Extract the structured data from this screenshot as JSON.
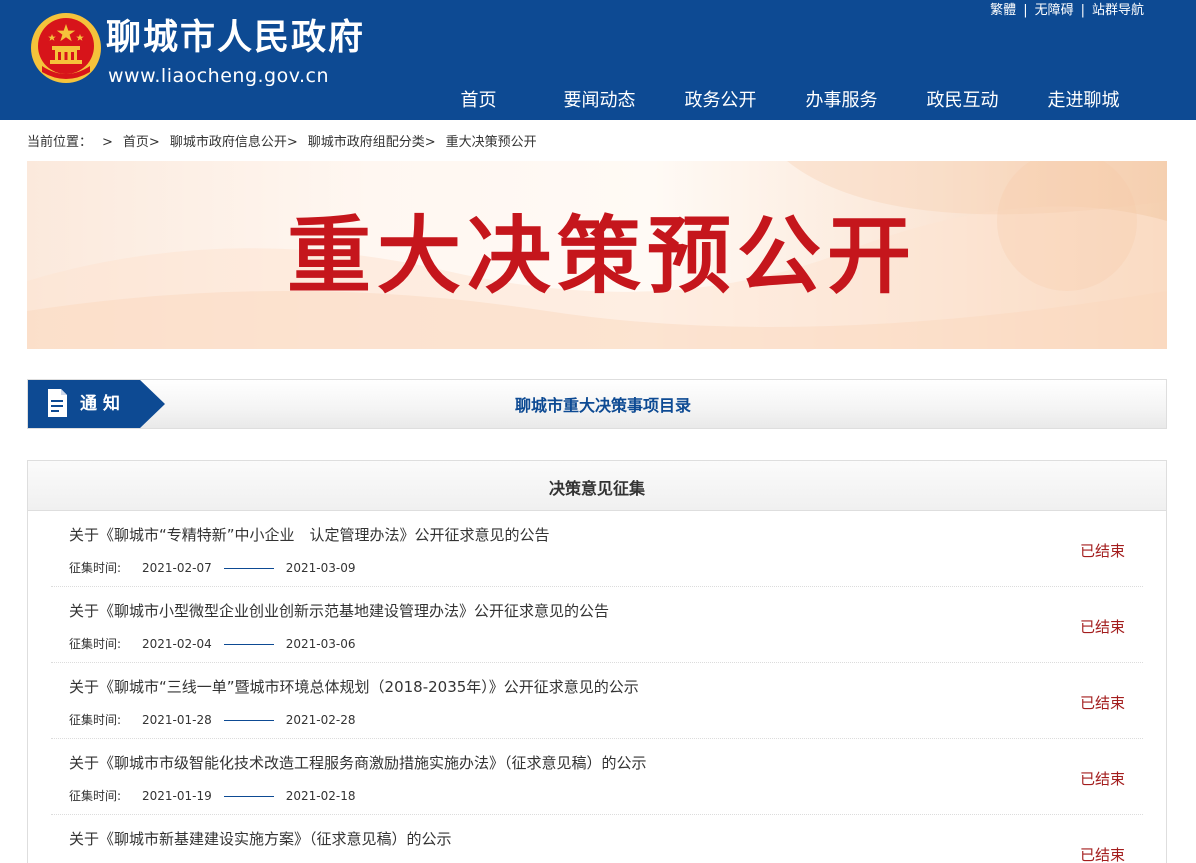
{
  "header": {
    "site_name": "聊城市人民政府",
    "domain": "www.liaocheng.gov.cn",
    "top_links": [
      "繁體",
      "无障碍",
      "站群导航"
    ],
    "nav": [
      "首页",
      "要闻动态",
      "政务公开",
      "办事服务",
      "政民互动",
      "走进聊城"
    ],
    "colors": {
      "brand_blue": "#0d4a93",
      "emblem_red": "#d7141a",
      "emblem_gold": "#f5c33b"
    }
  },
  "breadcrumb": [
    "当前位置：",
    ">",
    "首页>",
    "聊城市政府信息公开>",
    "聊城市政府组配分类>",
    "重大决策预公开"
  ],
  "banner": {
    "title": "重大决策预公开",
    "title_color": "#c5161c"
  },
  "notice": {
    "label": "通知",
    "text": "聊城市重大决策事项目录",
    "icon": "document-icon"
  },
  "panel": {
    "title": "决策意见征集",
    "meta_label": "征集时间:",
    "items": [
      {
        "title": "关于《聊城市“专精特新”中小企业　认定管理办法》公开征求意见的公告",
        "start": "2021-02-07",
        "end": "2021-03-09",
        "status": "已结束"
      },
      {
        "title": "关于《聊城市小型微型企业创业创新示范基地建设管理办法》公开征求意见的公告",
        "start": "2021-02-04",
        "end": "2021-03-06",
        "status": "已结束"
      },
      {
        "title": "关于《聊城市“三线一单”暨城市环境总体规划（2018-2035年）》公开征求意见的公示",
        "start": "2021-01-28",
        "end": "2021-02-28",
        "status": "已结束"
      },
      {
        "title": "关于《聊城市市级智能化技术改造工程服务商激励措施实施办法》（征求意见稿）的公示",
        "start": "2021-01-19",
        "end": "2021-02-18",
        "status": "已结束"
      },
      {
        "title": "关于《聊城市新基建建设实施方案》（征求意见稿）的公示",
        "start": "",
        "end": "",
        "status": "已结束"
      }
    ],
    "status_color": "#a31d1d"
  }
}
